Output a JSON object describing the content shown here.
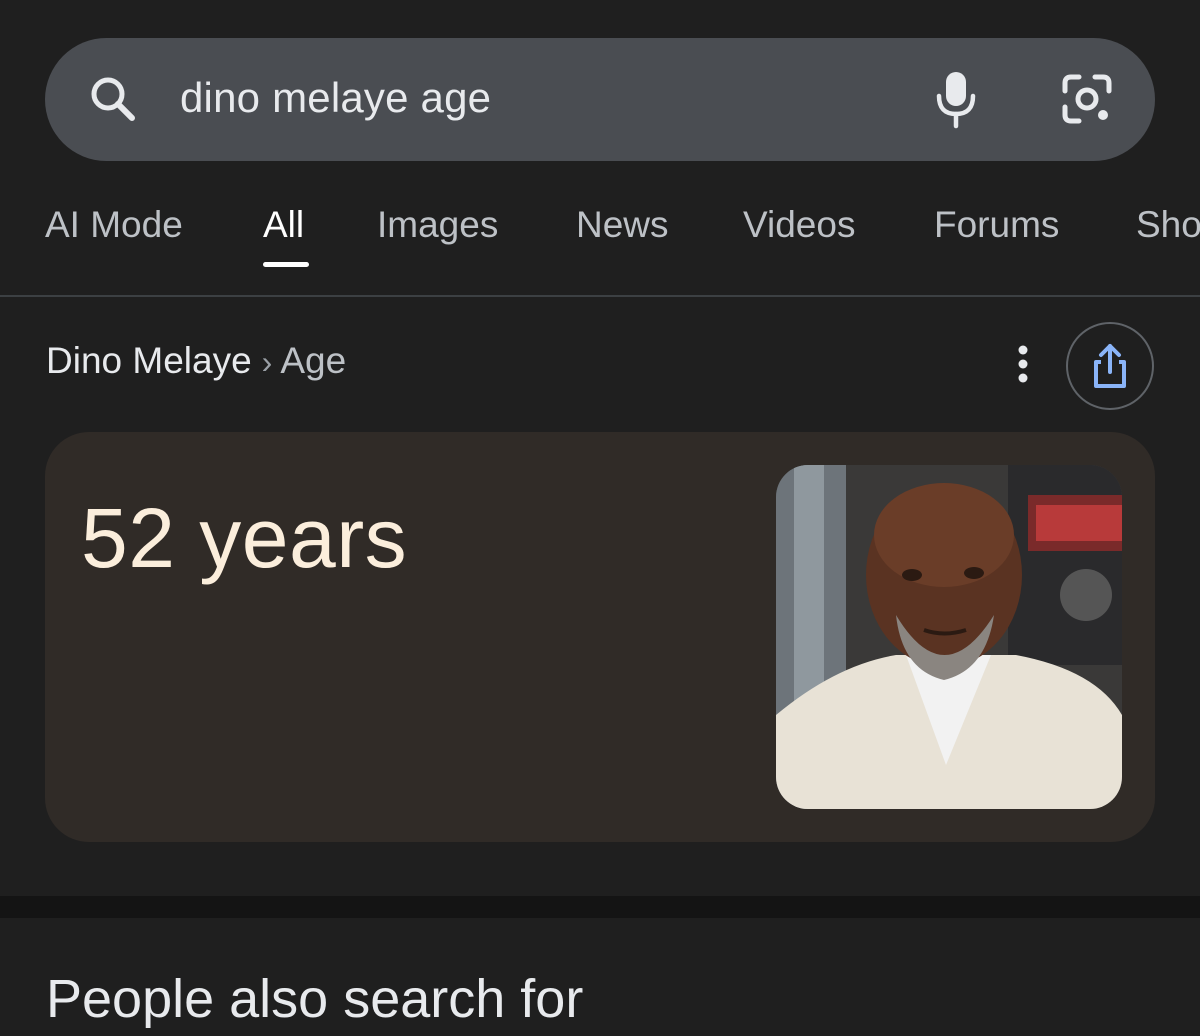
{
  "search": {
    "query": "dino melaye age",
    "icons": {
      "search": "search-icon",
      "voice": "mic-icon",
      "lens": "camera-lens-icon"
    }
  },
  "tabs": [
    {
      "label": "AI Mode",
      "active": false
    },
    {
      "label": "All",
      "active": true
    },
    {
      "label": "Images",
      "active": false
    },
    {
      "label": "News",
      "active": false
    },
    {
      "label": "Videos",
      "active": false
    },
    {
      "label": "Forums",
      "active": false
    },
    {
      "label": "Sho",
      "active": false
    }
  ],
  "breadcrumb": {
    "entity": "Dino Melaye",
    "separator": "›",
    "attribute": "Age"
  },
  "answer": {
    "value": "52 years",
    "image_description_icon": "person-photo"
  },
  "section": {
    "heading": "People also search for"
  },
  "colors": {
    "background": "#1f1f1f",
    "search_bar": "#4a4d52",
    "card": "#302b27",
    "answer_text": "#fbeedc",
    "share_icon": "#8ab4f8"
  }
}
